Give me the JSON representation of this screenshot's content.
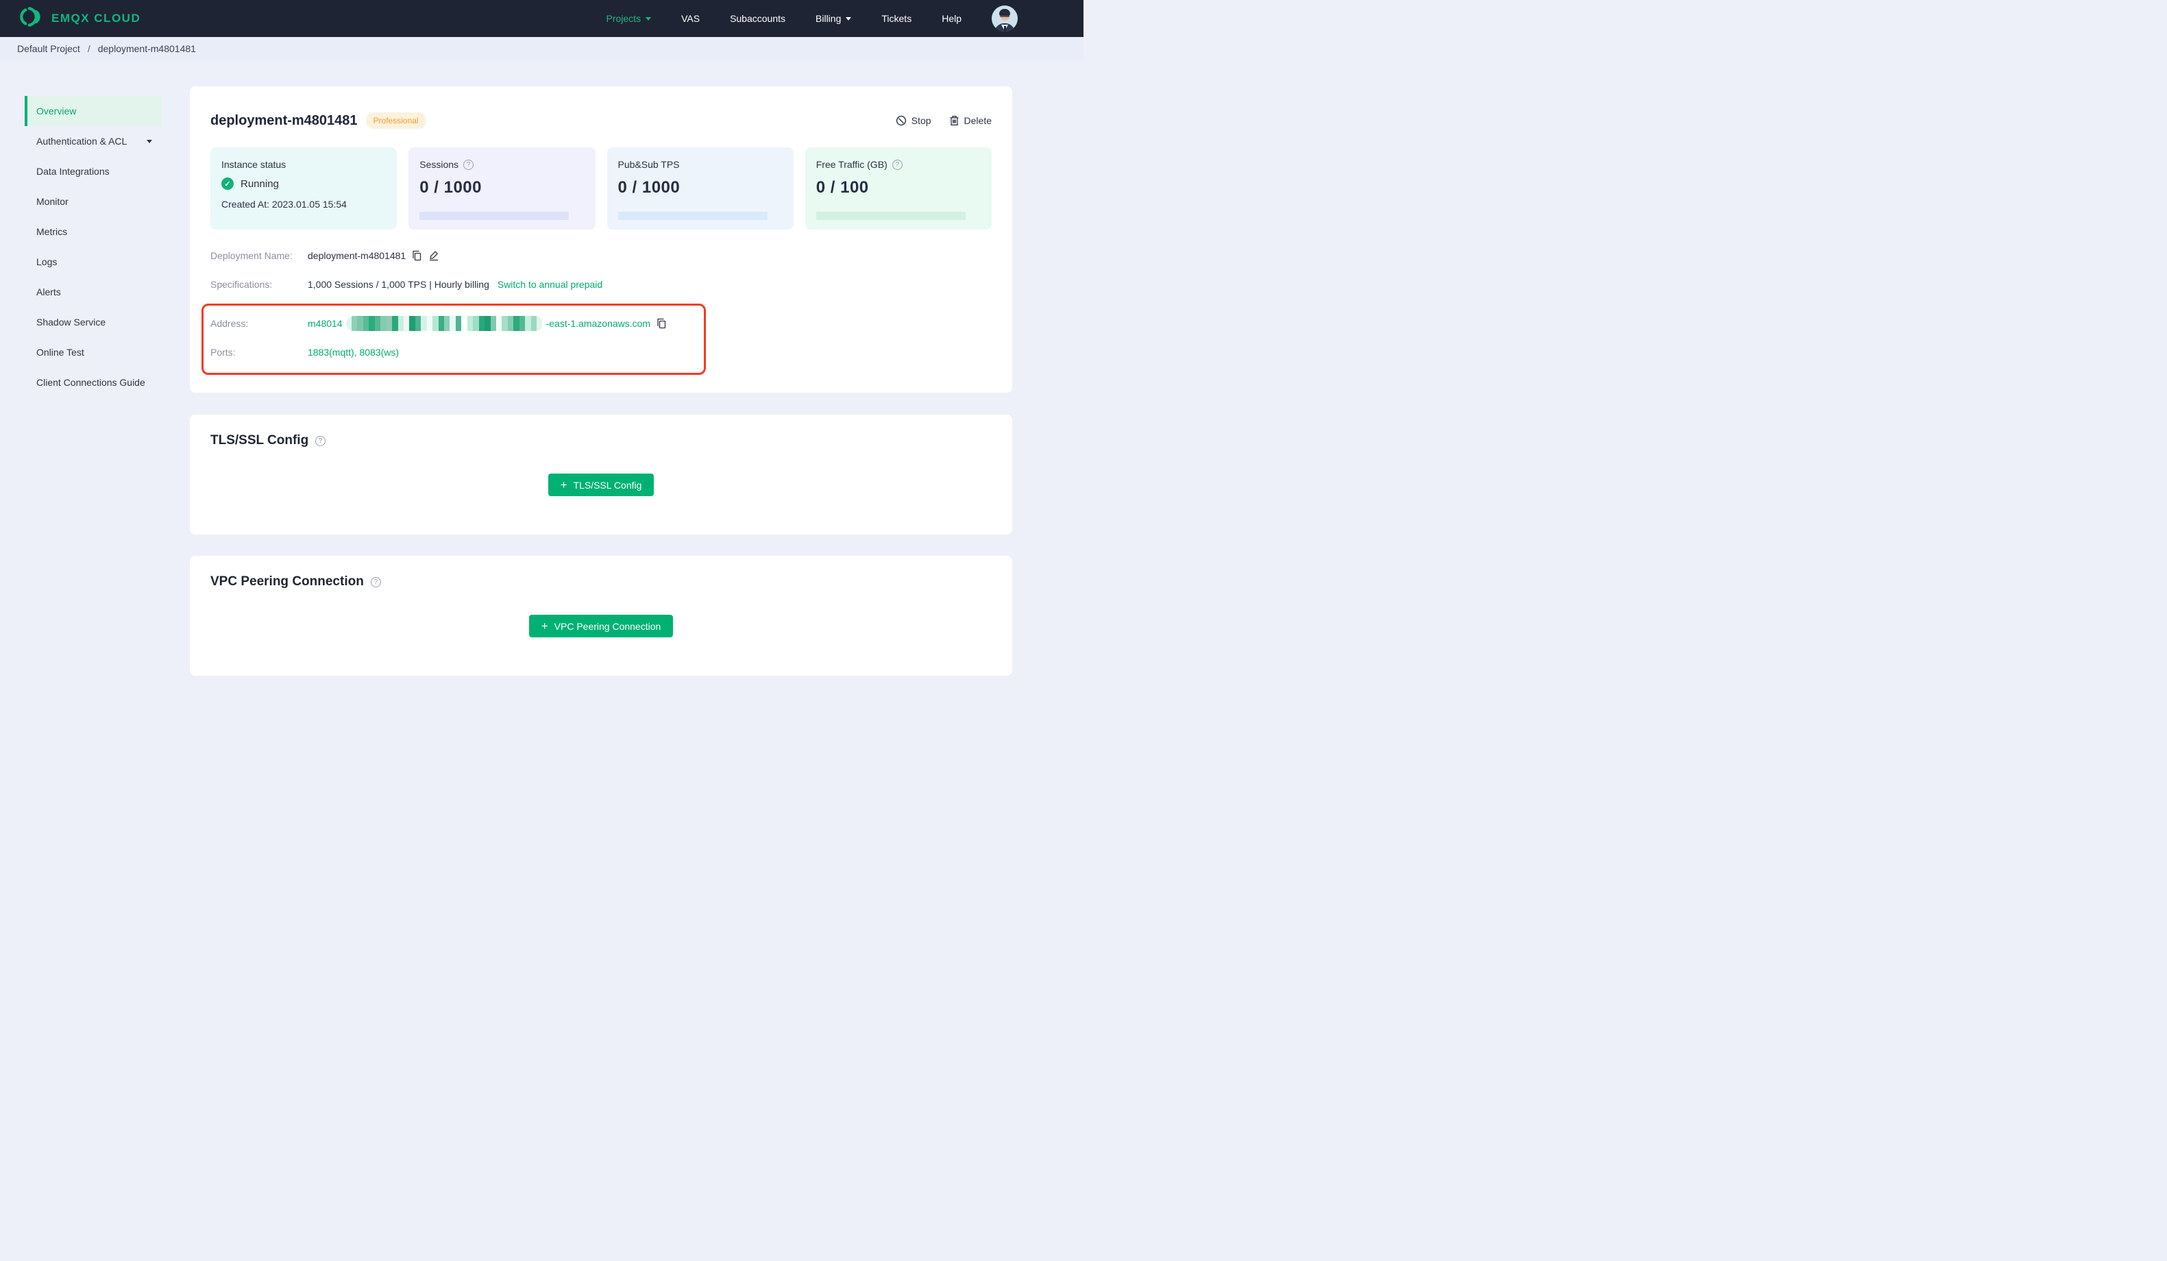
{
  "nav": {
    "brand": "EMQX CLOUD",
    "items": [
      {
        "label": "Projects",
        "caret": true,
        "active": true
      },
      {
        "label": "VAS"
      },
      {
        "label": "Subaccounts"
      },
      {
        "label": "Billing",
        "caret": true
      },
      {
        "label": "Tickets"
      },
      {
        "label": "Help"
      }
    ]
  },
  "breadcrumb": {
    "project": "Default Project",
    "separator": "/",
    "current": "deployment-m4801481"
  },
  "sidebar": {
    "items": [
      {
        "label": "Overview",
        "active": true
      },
      {
        "label": "Authentication & ACL",
        "caret": true
      },
      {
        "label": "Data Integrations"
      },
      {
        "label": "Monitor"
      },
      {
        "label": "Metrics"
      },
      {
        "label": "Logs"
      },
      {
        "label": "Alerts"
      },
      {
        "label": "Shadow Service"
      },
      {
        "label": "Online Test"
      },
      {
        "label": "Client Connections Guide"
      }
    ]
  },
  "deployment": {
    "title": "deployment-m4801481",
    "plan_badge": "Professional",
    "actions": {
      "stop": "Stop",
      "delete": "Delete"
    },
    "stats": {
      "instance_status": {
        "label": "Instance status",
        "status": "Running",
        "created_at": "Created At: 2023.01.05 15:54"
      },
      "sessions": {
        "label": "Sessions",
        "value": "0 / 1000",
        "current": 0,
        "max": 1000
      },
      "pubsub_tps": {
        "label": "Pub&Sub TPS",
        "value": "0 / 1000",
        "current": 0,
        "max": 1000
      },
      "free_traffic": {
        "label": "Free Traffic (GB)",
        "value": "0 / 100",
        "current": 0,
        "max": 100
      }
    },
    "details": {
      "name_label": "Deployment Name:",
      "name_value": "deployment-m4801481",
      "spec_label": "Specifications:",
      "spec_value": "1,000 Sessions / 1,000 TPS | Hourly billing",
      "spec_link": "Switch to annual prepaid",
      "address_label": "Address:",
      "address_prefix": "m48014",
      "address_suffix": "-east-1.amazonaws.com",
      "address_redaction_stripes": [
        "#dff8ef",
        "#8fd0b8",
        "#7cc7ac",
        "#5bbb97",
        "#2cab7d",
        "#55b794",
        "#83cbb2",
        "#8fccb4",
        "#2aa97c",
        "#c9eedd",
        "#eef9f4",
        "#1d9f73",
        "#4cb38e",
        "#d4f3e7",
        "#f2fcf8",
        "#b5e7d3",
        "#3cae86",
        "#88d1b6",
        "#e8f9f2",
        "#50b691",
        "#ffffff",
        "#bfecd9",
        "#9eddc6",
        "#28a87b",
        "#1d9f73",
        "#7ecaae",
        "#f6fdfa",
        "#a3dfc9",
        "#86ccb1",
        "#2cab7d",
        "#55b794",
        "#c4eedd",
        "#9bd8c0",
        "#dff6ed"
      ],
      "ports_label": "Ports:",
      "ports_value": "1883(mqtt), 8083(ws)"
    }
  },
  "sections": {
    "tls": {
      "heading": "TLS/SSL Config",
      "button_label": "TLS/SSL Config"
    },
    "vpc": {
      "heading": "VPC Peering Connection",
      "button_label": "VPC Peering Connection"
    }
  },
  "colors": {
    "brand_green": "#00b173",
    "nav_bg": "#1e2433",
    "active_item_green": "#00ab70",
    "badge_orange": "#f59d28",
    "running_green": "#0db574",
    "annotation_red": "#f63b1f"
  }
}
